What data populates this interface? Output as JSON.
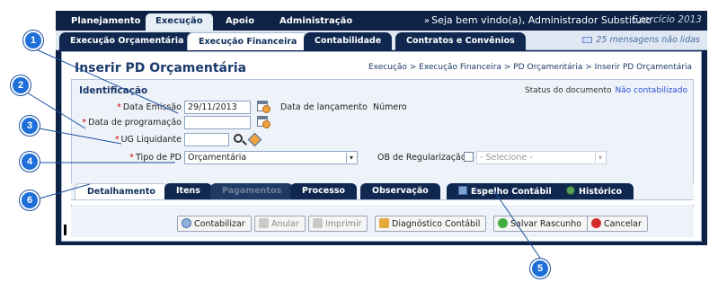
{
  "menu": {
    "items": [
      {
        "label": "Planejamento",
        "active": false
      },
      {
        "label": "Execução",
        "active": true
      },
      {
        "label": "Apoio",
        "active": false
      },
      {
        "label": "Administração",
        "active": false
      }
    ],
    "welcome": "Seja bem vindo(a), Administrador Substituto",
    "exercicio": "Exercício 2013"
  },
  "submenu": {
    "items": [
      {
        "label": "Execução Orçamentária",
        "active": false
      },
      {
        "label": "Execução Financeira",
        "active": true
      },
      {
        "label": "Contabilidade",
        "active": false
      },
      {
        "label": "Contratos e Convênios",
        "active": false
      }
    ],
    "messages": "25 mensagens não lidas"
  },
  "page": {
    "title": "Inserir PD Orçamentária",
    "breadcrumb": "Execução > Execução Financeira > PD Orçamentária > Inserir PD Orçamentária"
  },
  "identificacao": {
    "section_title": "Identificação",
    "status_label": "Status do documento",
    "status_value": "Não contabilizado",
    "data_emissao": {
      "label": "Data Emissão",
      "value": "29/11/2013"
    },
    "data_lancamento": {
      "label": "Data de lançamento"
    },
    "numero": {
      "label": "Número"
    },
    "data_programacao": {
      "label": "Data de programação",
      "value": ""
    },
    "ug_liquidante": {
      "label": "UG Liquidante",
      "value": ""
    },
    "tipo_pd": {
      "label": "Tipo de PD",
      "value": "Orçamentária"
    },
    "ob_regularizacao": {
      "label": "OB de Regularização",
      "checked": false
    },
    "ob_select": {
      "value": "- Selecione -"
    },
    "required_mark": "*"
  },
  "tabs": [
    {
      "label": "Detalhamento",
      "state": "active"
    },
    {
      "label": "Itens",
      "state": "normal"
    },
    {
      "label": "Pagamentos",
      "state": "disabled"
    },
    {
      "label": "Processo",
      "state": "normal"
    },
    {
      "label": "Observação",
      "state": "normal"
    },
    {
      "label": "Espelho Contábil",
      "state": "normal",
      "icon": "grid-icon"
    },
    {
      "label": "Histórico",
      "state": "normal",
      "icon": "globe-icon"
    }
  ],
  "buttons": {
    "contabilizar": {
      "label": "Contabilizar",
      "icon": "gear-icon"
    },
    "anular": {
      "label": "Anular",
      "icon": "undo-icon"
    },
    "imprimir": {
      "label": "Imprimir",
      "icon": "printer-icon"
    },
    "diagnostico": {
      "label": "Diagnóstico Contábil",
      "icon": "diagnostic-icon"
    },
    "salvar": {
      "label": "Salvar Rascunho",
      "icon": "save-icon"
    },
    "cancelar": {
      "label": "Cancelar",
      "icon": "cancel-icon"
    }
  },
  "callouts": [
    "1",
    "2",
    "3",
    "4",
    "5",
    "6"
  ],
  "colors": {
    "callout": "#1f6fd8",
    "header": "#0d2244",
    "status_value": "#2c53d6"
  }
}
